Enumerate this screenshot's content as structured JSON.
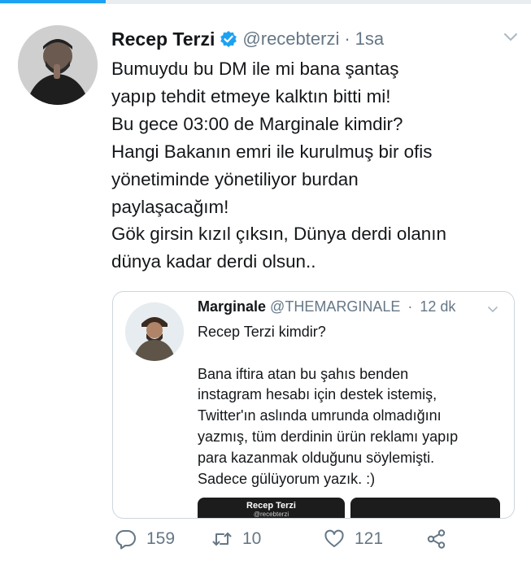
{
  "tweet": {
    "name": "Recep Terzi",
    "handle": "@recebterzi",
    "separator": "·",
    "time": "1sa",
    "lines": [
      "Bumuydu bu DM ile mi bana şantaş",
      "yapıp tehdit etmeye kalktın bitti mi!",
      "Bu gece 03:00 de Marginale kimdir?",
      "Hangi Bakanın emri ile kurulmuş bir ofis",
      "yönetiminde yönetiliyor burdan",
      "paylaşacağım!",
      "Gök girsin kızıl çıksın, Dünya derdi olanın",
      "dünya kadar derdi olsun.."
    ]
  },
  "quoted": {
    "name": "Marginale",
    "handle": "@THEMARGINALE",
    "separator": "·",
    "time": "12 dk",
    "lines": [
      "Recep Terzi kimdir?",
      "",
      "Bana iftira atan bu şahıs benden",
      "instagram hesabı için destek istemiş,",
      "Twitter'ın aslında umrunda olmadığını",
      "yazmış, tüm derdinin ürün reklamı yapıp",
      "para kazanmak olduğunu söylemişti.",
      "Sadece gülüyorum yazık. :)"
    ],
    "media": {
      "name": "Recep Terzi",
      "handle": "@recebterzi"
    }
  },
  "actions": {
    "replies": "159",
    "retweets": "10",
    "likes": "121"
  },
  "colors": {
    "accent": "#1da1f2",
    "secondary": "#657786",
    "border": "#ccd6dd"
  },
  "icons": [
    "verified-badge-icon",
    "chevron-down-icon",
    "reply-icon",
    "retweet-icon",
    "like-icon",
    "share-icon"
  ]
}
